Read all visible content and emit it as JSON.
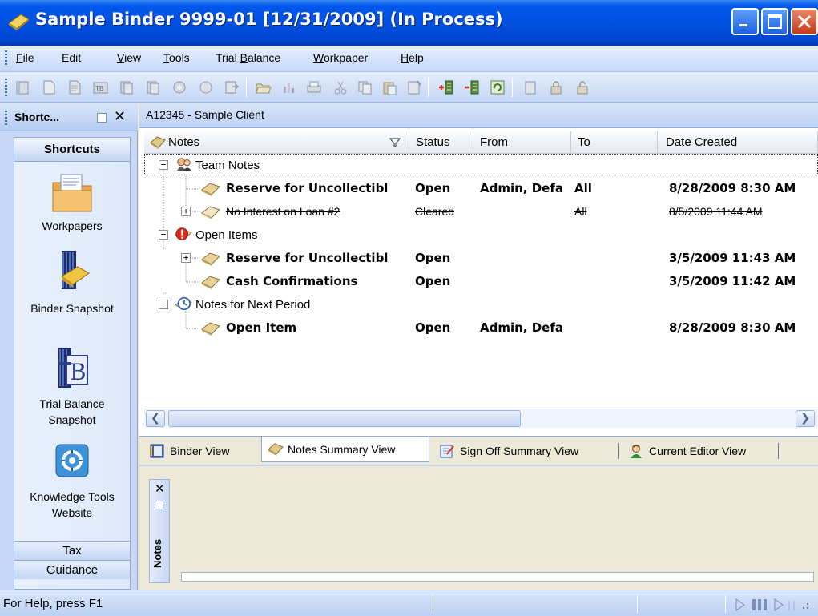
{
  "window": {
    "title": "Sample Binder 9999-01 [12/31/2009] (In Process)"
  },
  "menu": [
    {
      "label": "File",
      "accel": "F"
    },
    {
      "label": "Edit"
    },
    {
      "label": "View",
      "accel": "V"
    },
    {
      "label": "Tools",
      "accel": "T"
    },
    {
      "label": "Trial Balance",
      "accel": "B"
    },
    {
      "label": "Workpaper",
      "accel": "W"
    },
    {
      "label": "Help",
      "accel": "H"
    }
  ],
  "shortcuts_panel": {
    "header": "Shortc...",
    "section_title": "Shortcuts",
    "items": [
      {
        "label": "Workpapers",
        "icon": "workpapers-folder-icon"
      },
      {
        "label": "Binder Snapshot",
        "icon": "binder-snapshot-icon"
      },
      {
        "label": "Trial Balance Snapshot",
        "icon": "trial-balance-snapshot-icon"
      },
      {
        "label": "Knowledge Tools Website",
        "icon": "knowledge-tools-icon"
      }
    ],
    "tabs": [
      "Tax",
      "Guidance"
    ]
  },
  "client": "A12345 - Sample Client",
  "grid": {
    "columns": [
      "Notes",
      "Status",
      "From",
      "To",
      "Date Created"
    ],
    "groups": [
      {
        "label": "Team Notes",
        "rows": [
          {
            "note": "Reserve for Uncollectibl",
            "status": "Open",
            "from": "Admin, Defa",
            "to": "All",
            "date": "8/28/2009 8:30 AM",
            "style": "bold",
            "expandable": false
          },
          {
            "note": "No Interest on Loan #2",
            "status": "Cleared",
            "from": "",
            "to": "All",
            "date": "8/5/2009 11:44 AM",
            "style": "strike",
            "expandable": true
          }
        ]
      },
      {
        "label": "Open Items",
        "rows": [
          {
            "note": "Reserve for Uncollectibl",
            "status": "Open",
            "from": "",
            "to": "",
            "date": "3/5/2009 11:43 AM",
            "style": "bold",
            "expandable": true
          },
          {
            "note": "Cash Confirmations",
            "status": "Open",
            "from": "",
            "to": "",
            "date": "3/5/2009 11:42 AM",
            "style": "bold",
            "expandable": false
          }
        ]
      },
      {
        "label": "Notes for Next Period",
        "rows": [
          {
            "note": "Open Item",
            "status": "Open",
            "from": "Admin, Defa",
            "to": "",
            "date": "8/28/2009 8:30 AM",
            "style": "bold",
            "expandable": false
          }
        ]
      }
    ]
  },
  "view_tabs": [
    {
      "label": "Binder View",
      "active": false
    },
    {
      "label": "Notes Summary View",
      "active": true
    },
    {
      "label": "Sign Off Summary View",
      "active": false
    },
    {
      "label": "Current Editor View",
      "active": false
    }
  ],
  "notes_pane": {
    "label": "Notes"
  },
  "status": {
    "text": "For Help, press F1"
  }
}
